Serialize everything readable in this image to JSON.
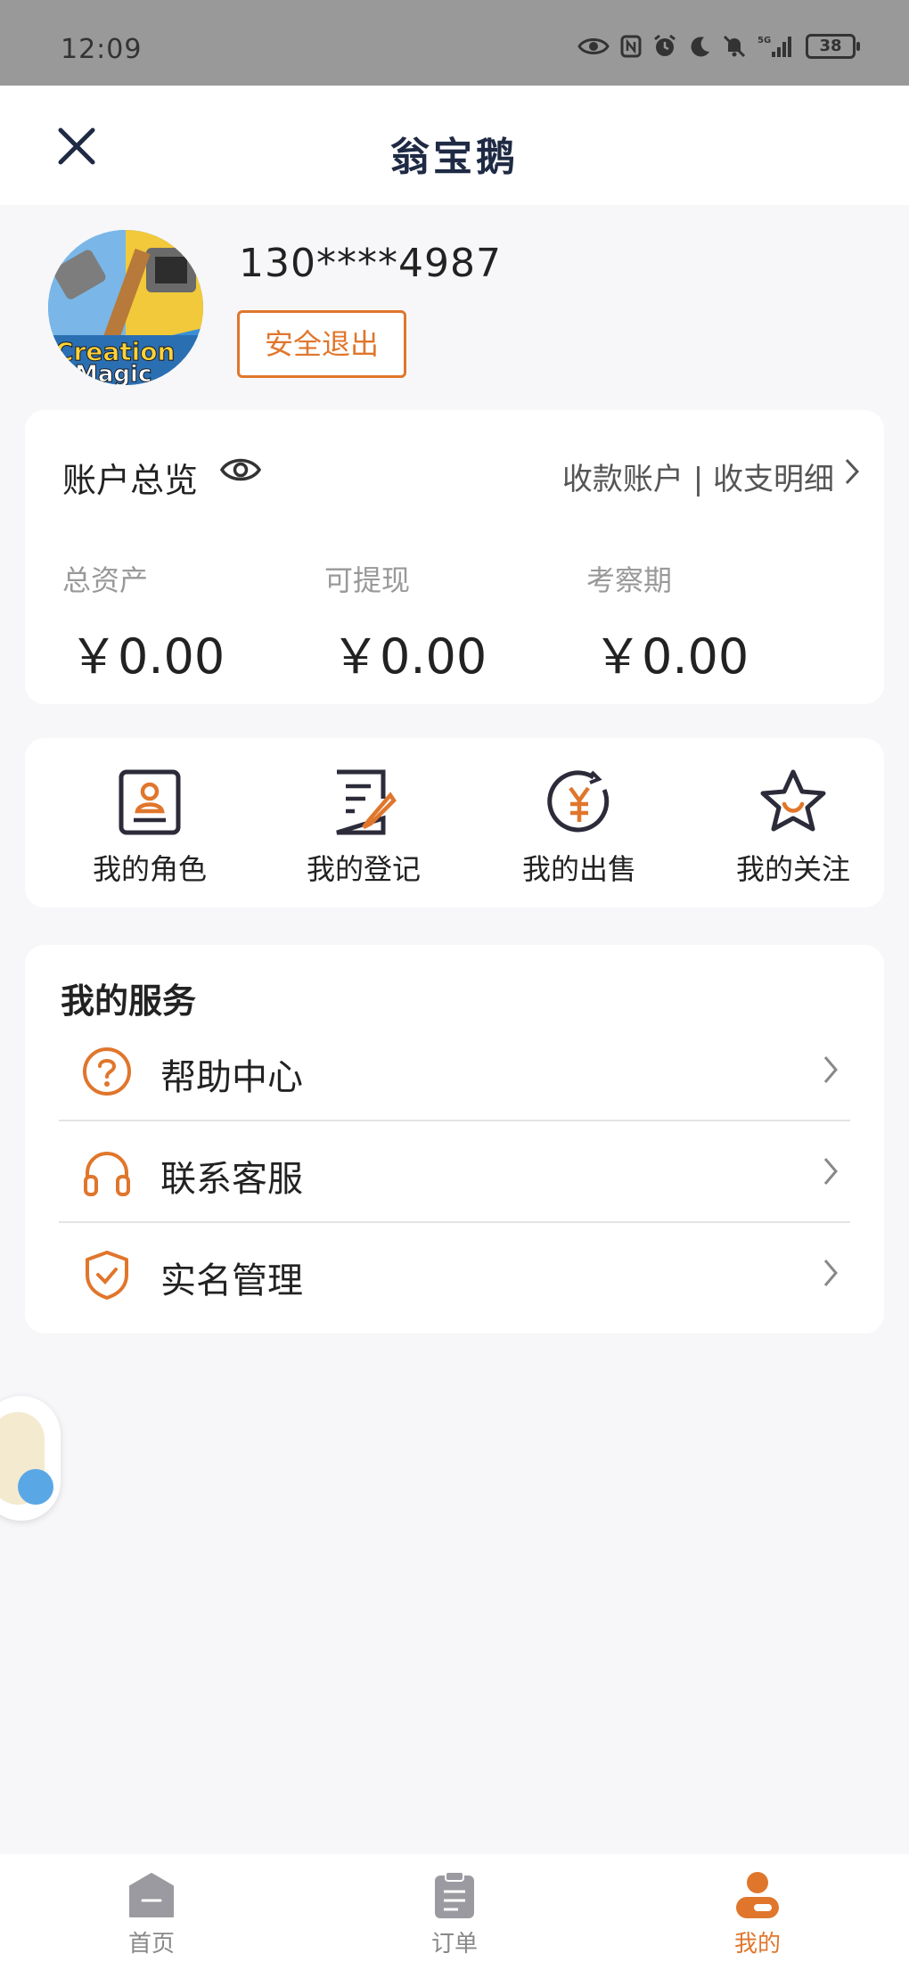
{
  "status_bar": {
    "time": "12:09",
    "battery": "38",
    "icons": [
      "eye-icon",
      "nfc-icon",
      "alarm-icon",
      "moon-icon",
      "mute-icon",
      "signal-5g-icon",
      "battery-icon"
    ]
  },
  "nav": {
    "title": "翁宝鹅",
    "close_icon": "close-icon"
  },
  "profile": {
    "phone": "130****4987",
    "logout_label": "安全退出"
  },
  "account": {
    "title": "账户总览",
    "links": "收款账户 | 收支明细",
    "columns": [
      {
        "label": "总资产",
        "value": "￥0.00"
      },
      {
        "label": "可提现",
        "value": "￥0.00"
      },
      {
        "label": "考察期",
        "value": "￥0.00"
      }
    ]
  },
  "menu": {
    "items": [
      {
        "label": "我的角色",
        "icon": "role-icon"
      },
      {
        "label": "我的登记",
        "icon": "register-icon"
      },
      {
        "label": "我的出售",
        "icon": "sale-icon"
      },
      {
        "label": "我的关注",
        "icon": "star-icon"
      }
    ]
  },
  "services": {
    "title": "我的服务",
    "items": [
      {
        "label": "帮助中心",
        "icon": "help-icon"
      },
      {
        "label": "联系客服",
        "icon": "headset-icon"
      },
      {
        "label": "实名管理",
        "icon": "shield-check-icon"
      }
    ]
  },
  "tab_bar": {
    "tabs": [
      {
        "label": "首页",
        "icon": "home-icon",
        "active": false
      },
      {
        "label": "订单",
        "icon": "order-icon",
        "active": false
      },
      {
        "label": "我的",
        "icon": "profile-icon",
        "active": true
      }
    ]
  },
  "colors": {
    "accent": "#e0762c",
    "dark_icon": "#2b2b3a",
    "status_bar": "#999999",
    "page_bg": "#f7f7f9"
  }
}
